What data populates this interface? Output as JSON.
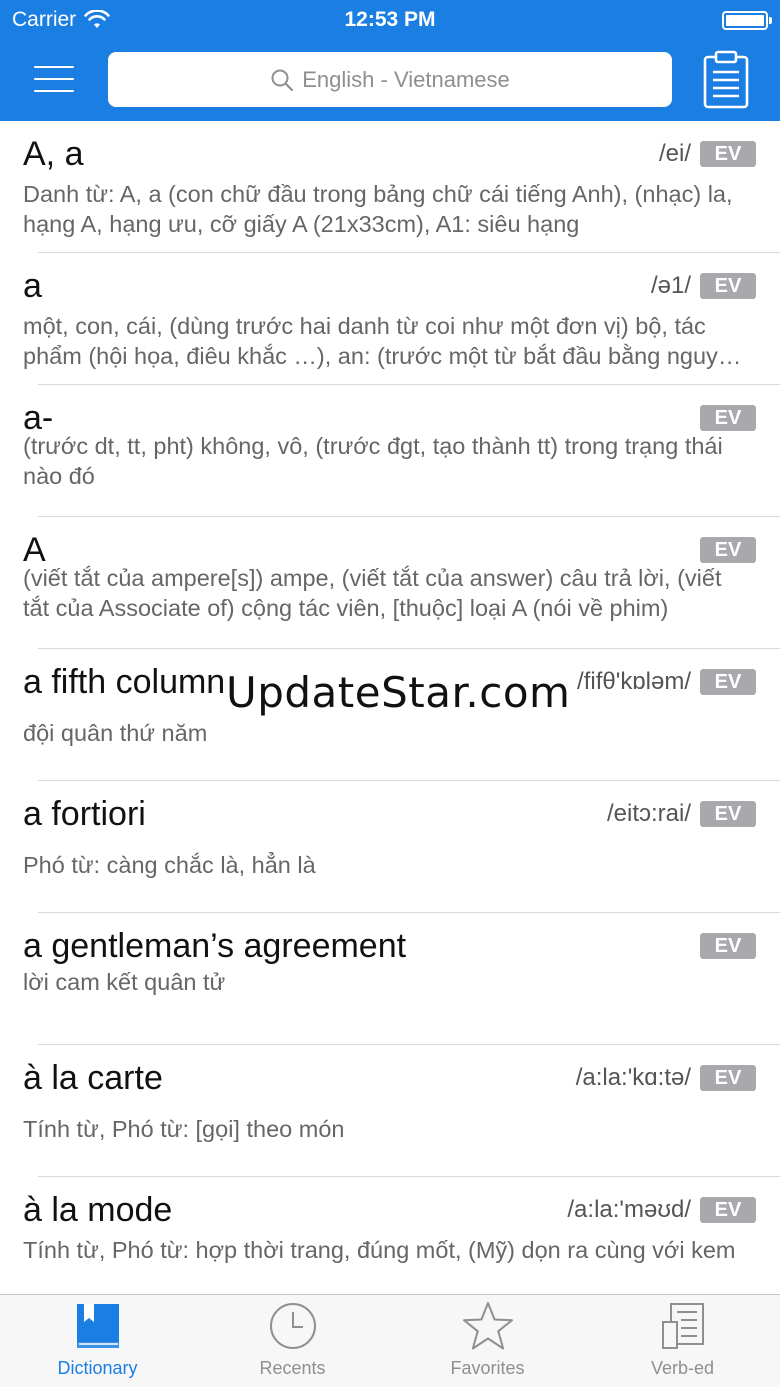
{
  "status_bar": {
    "carrier": "Carrier",
    "time": "12:53 PM"
  },
  "nav": {
    "search_placeholder": "English - Vietnamese"
  },
  "entries": [
    {
      "word": "A, a",
      "ipa": "/ei/",
      "tag": "EV",
      "definition": "Danh từ: A, a (con chữ đầu trong bảng chữ cái tiếng Anh), (nhạc) la, hạng A, hạng ưu, cỡ giấy A (21x33cm), A1: siêu hạng"
    },
    {
      "word": "a",
      "ipa": "/ə1/",
      "tag": "EV",
      "definition": "một, con, cái, (dùng trước hai danh từ coi như một đơn vị) bộ, tác phẩm (hội họa, điêu khắc …), an: (trước một từ bắt đầu bằng nguyên âm)"
    },
    {
      "word": "a-",
      "ipa": "",
      "tag": "EV",
      "definition": "(trước dt, tt, pht) không, vô, (trước đgt, tạo thành tt) trong trạng thái nào đó"
    },
    {
      "word": "A",
      "ipa": "",
      "tag": "EV",
      "definition": "(viết tắt của ampere[s]) ampe, (viết tắt của answer) câu trả lời, (viết tắt của Associate of) cộng tác viên, [thuộc] loại A (nói về phim)"
    },
    {
      "word": "a fifth column",
      "ipa": "/fifθ'kɒləm/",
      "tag": "EV",
      "definition": "đội quân thứ năm"
    },
    {
      "word": "a fortiori",
      "ipa": "/eitɔ:rai/",
      "tag": "EV",
      "definition": "Phó từ: càng chắc là, hẳn là"
    },
    {
      "word": "a gentleman’s agreement",
      "ipa": "",
      "tag": "EV",
      "definition": "lời cam kết quân tử"
    },
    {
      "word": "à la carte",
      "ipa": "/a:la:'kɑ:tə/",
      "tag": "EV",
      "definition": "Tính từ, Phó từ: [gọi] theo món"
    },
    {
      "word": "à la mode",
      "ipa": "/a:la:'məʊd/",
      "tag": "EV",
      "definition": "Tính từ, Phó từ: hợp thời trang, đúng mốt, (Mỹ) dọn ra cùng với kem"
    }
  ],
  "watermark": "UpdateStar.com",
  "tabs": [
    {
      "label": "Dictionary",
      "icon": "book-icon",
      "active": true
    },
    {
      "label": "Recents",
      "icon": "clock-icon",
      "active": false
    },
    {
      "label": "Favorites",
      "icon": "star-icon",
      "active": false
    },
    {
      "label": "Verb-ed",
      "icon": "document-icon",
      "active": false
    }
  ],
  "colors": {
    "accent": "#1b7ee3",
    "badge": "#a9a9ad"
  }
}
